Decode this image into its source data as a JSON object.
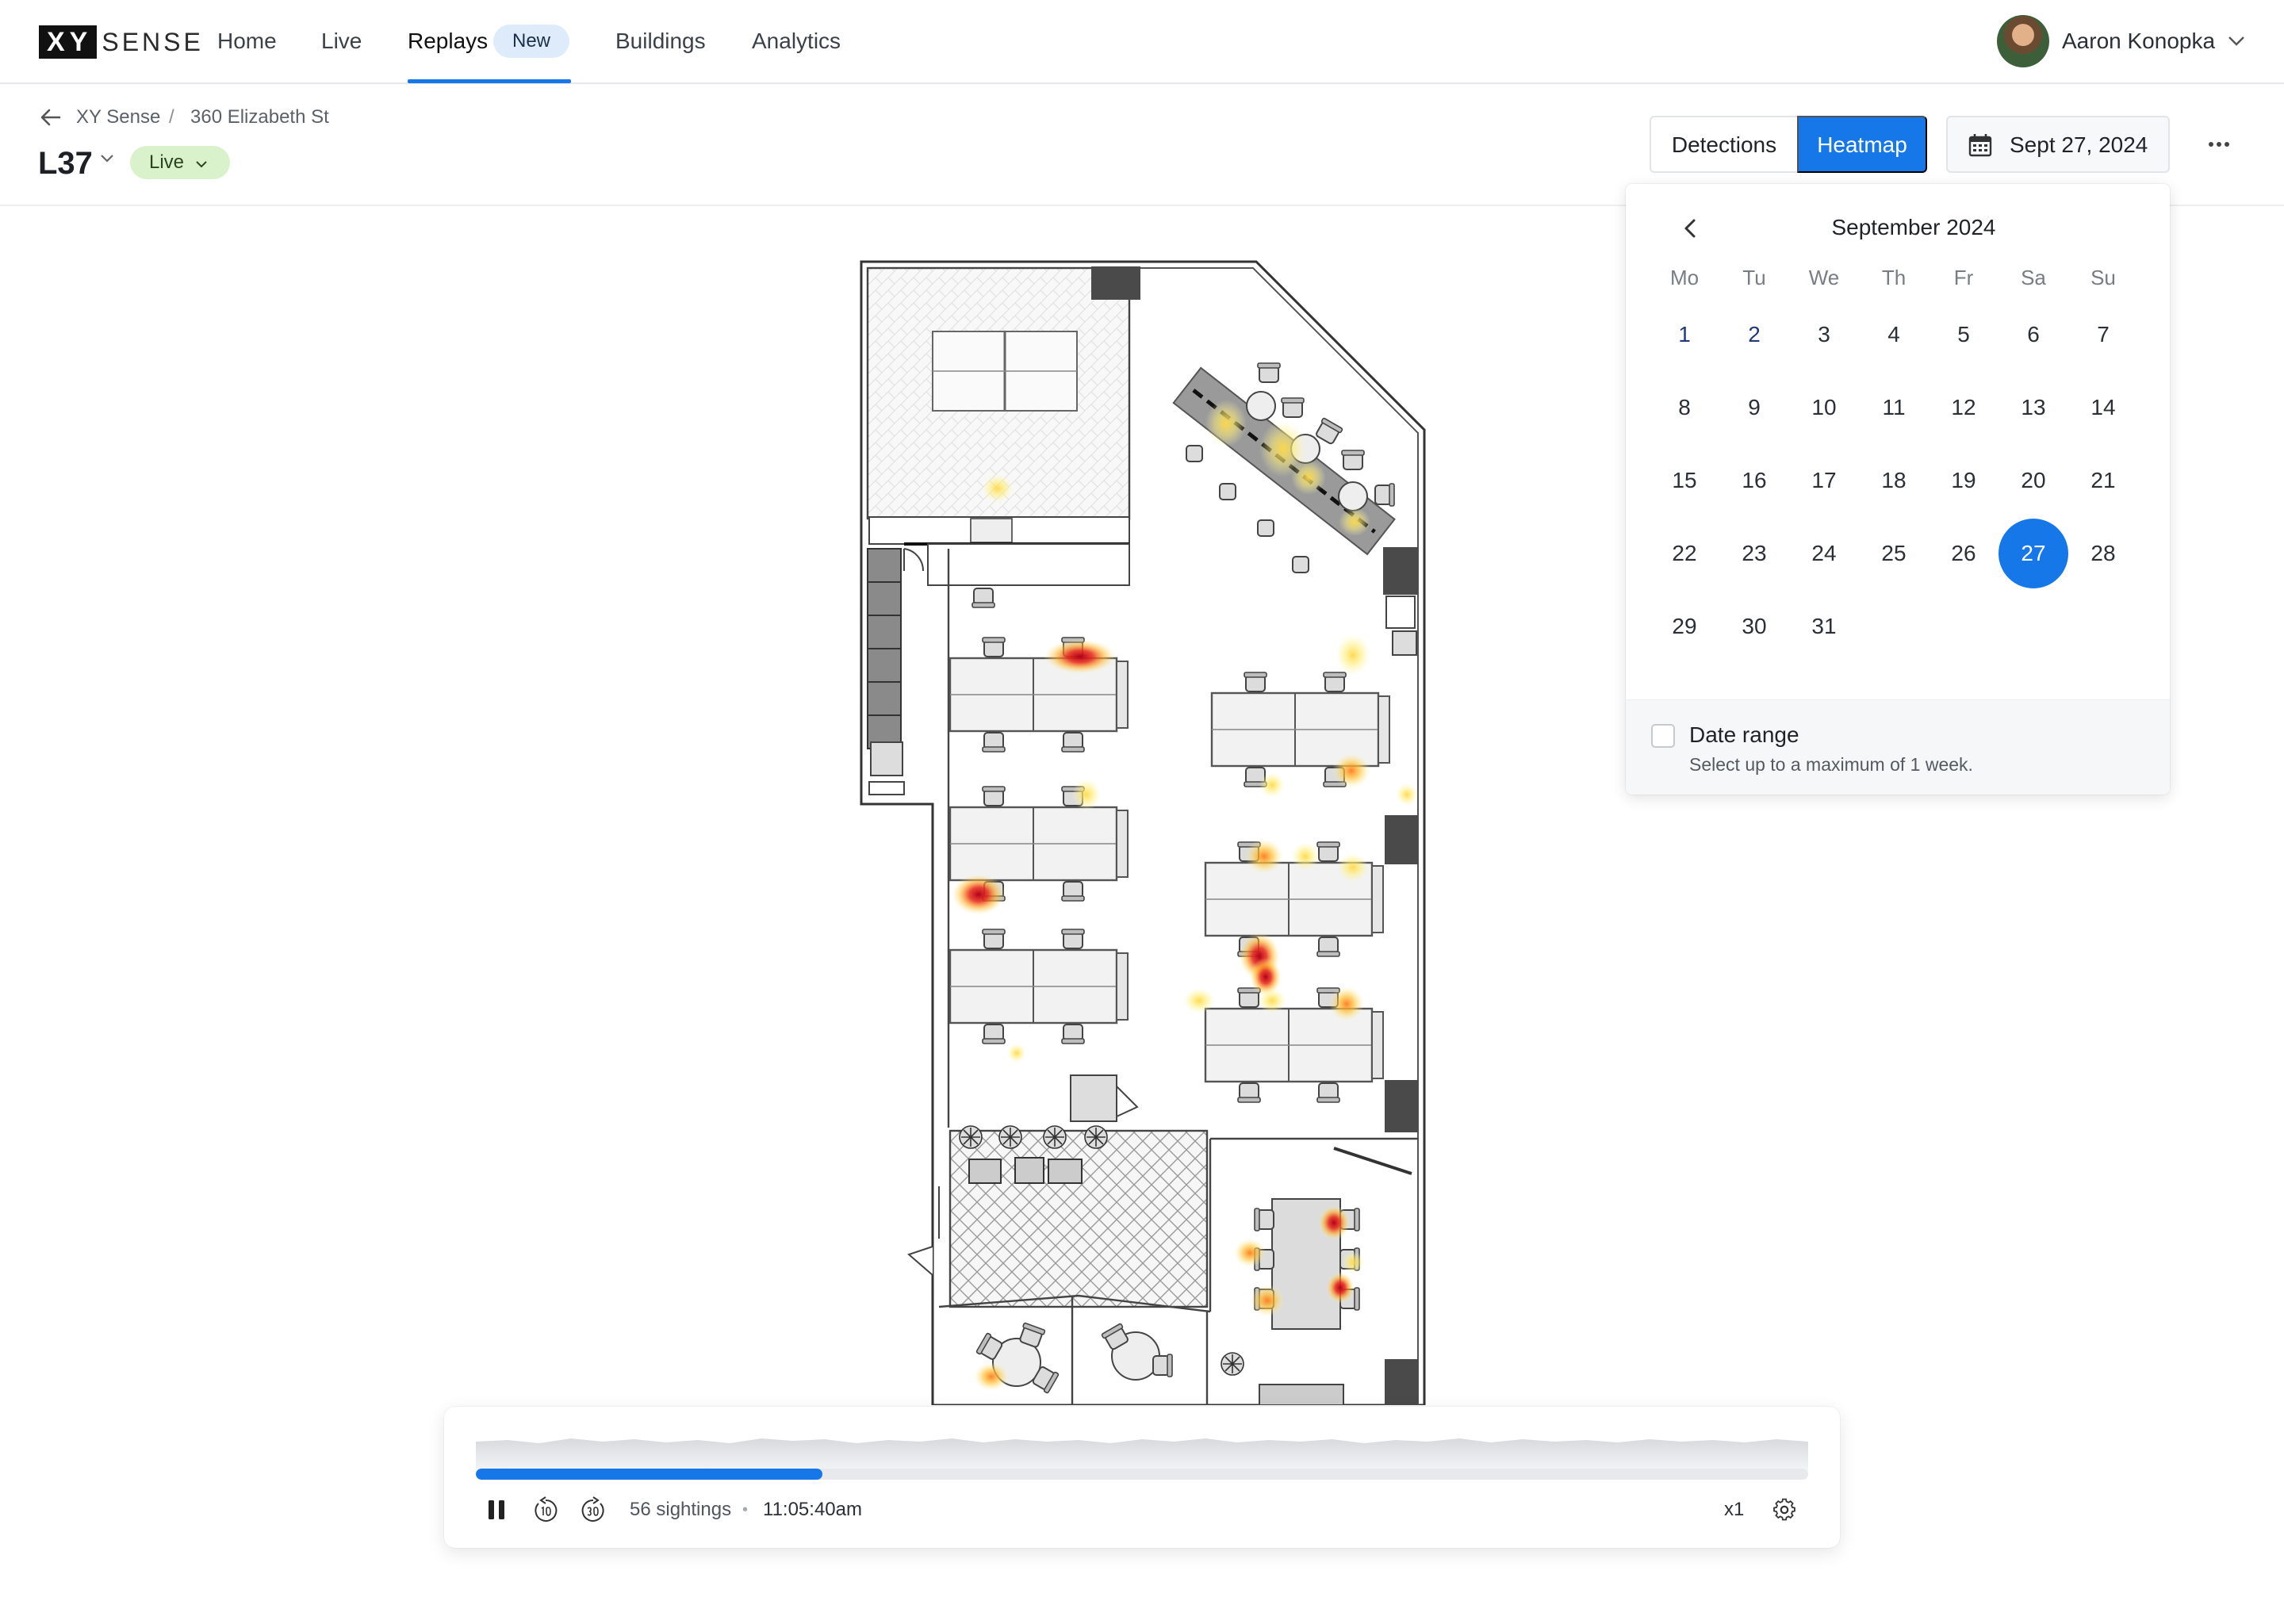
{
  "app": {
    "logo_mark": "XY",
    "logo_text": "SENSE"
  },
  "nav": {
    "items": [
      {
        "label": "Home"
      },
      {
        "label": "Live"
      },
      {
        "label": "Replays",
        "badge": "New"
      },
      {
        "label": "Buildings"
      },
      {
        "label": "Analytics"
      }
    ],
    "active": "Replays",
    "accent_color": "#1677e8"
  },
  "user": {
    "name": "Aaron Konopka"
  },
  "breadcrumb": {
    "org": "XY Sense",
    "separator": "/",
    "building": "360 Elizabeth St"
  },
  "floor": {
    "name": "L37",
    "status": "Live",
    "status_color": "#d9f2cb"
  },
  "view_toggle": {
    "options": [
      "Detections",
      "Heatmap"
    ],
    "selected": "Heatmap"
  },
  "date_picker": {
    "label": "Sept 27, 2024",
    "month_title": "September 2024",
    "weekdays": [
      "Mo",
      "Tu",
      "We",
      "Th",
      "Fr",
      "Sa",
      "Su"
    ],
    "days": [
      "1",
      "2",
      "3",
      "4",
      "5",
      "6",
      "7",
      "8",
      "9",
      "10",
      "11",
      "12",
      "13",
      "14",
      "15",
      "16",
      "17",
      "18",
      "19",
      "20",
      "21",
      "22",
      "23",
      "24",
      "25",
      "26",
      "27",
      "28",
      "29",
      "30",
      "31"
    ],
    "highlighted_days": [
      "1",
      "2"
    ],
    "selected_day": "27",
    "range_label": "Date range",
    "range_hint": "Select up to a maximum of 1 week."
  },
  "player": {
    "progress": 0.26,
    "sightings": "56 sightings",
    "dot": "•",
    "time": "11:05:40am",
    "speed": "x1"
  },
  "icons": {
    "back": "arrow-left-icon",
    "calendar": "calendar-icon",
    "more": "more-horizontal-icon",
    "prev": "chevron-left-icon",
    "pause": "pause-icon",
    "rewind": "rewind-10-icon",
    "forward": "forward-30-icon",
    "settings": "gear-icon"
  }
}
